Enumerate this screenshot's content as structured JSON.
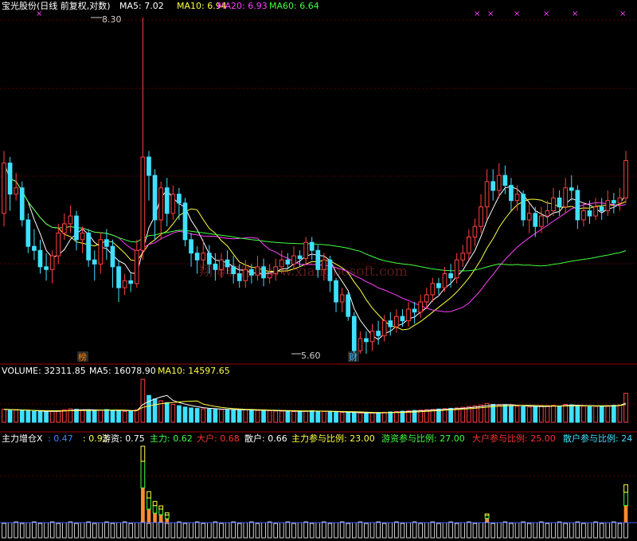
{
  "header": {
    "stock": "宝光股份(日线 前复权,对数)",
    "ma5_label": "MA5: 7.02",
    "ma10_label": "MA10: 6.94",
    "ma20_label": "MA20: 6.93",
    "ma60_label": "MA60: 6.64"
  },
  "price_panel": {
    "high_mark": "8.30",
    "low_mark": "5.60",
    "tag_bang": "榜",
    "tag_cai": "财",
    "watermark": "翔博软件 www.xiangbosoft.com"
  },
  "volume_panel": {
    "volume_label": "VOLUME: 32311.85",
    "ma5_label": "MA5: 16078.90",
    "ma10_label": "MA10: 14597.65"
  },
  "indicator_panel": {
    "name": "主力增仓X",
    "v1": ": 0.47",
    "v2": ": 0.93",
    "youzi": "游资: 0.75",
    "zhuli": "主力: 0.62",
    "dahu": "大户: 0.68",
    "sanhu": "散户: 0.66",
    "zhuli_ratio": "主力参与比例: 23.00",
    "youzi_ratio": "游资参与比例: 27.00",
    "dahu_ratio": "大户参与比例: 25.00",
    "sanhu_ratio": "散户参与比例: 24"
  },
  "colors": {
    "up": "#ff4040",
    "down": "#40e0ff",
    "ma5": "#ffffff",
    "ma10": "#ffff40",
    "ma20": "#ff40ff",
    "ma60": "#40ff40",
    "grid": "#700000"
  },
  "chart_data": [
    {
      "type": "candlestick",
      "price_range": [
        5.6,
        8.3
      ],
      "scale": "log",
      "candles": [
        [
          6.6,
          7.0,
          6.5,
          7.1
        ],
        [
          7.0,
          6.75,
          6.62,
          7.05
        ],
        [
          6.75,
          6.8,
          6.7,
          6.92
        ],
        [
          6.8,
          6.55,
          6.5,
          6.85
        ],
        [
          6.55,
          6.35,
          6.3,
          6.6
        ],
        [
          6.35,
          6.32,
          6.25,
          6.48
        ],
        [
          6.32,
          6.2,
          6.15,
          6.4
        ],
        [
          6.2,
          6.18,
          6.1,
          6.3
        ],
        [
          6.18,
          6.28,
          6.08,
          6.32
        ],
        [
          6.28,
          6.45,
          6.22,
          6.52
        ],
        [
          6.45,
          6.52,
          6.4,
          6.6
        ],
        [
          6.52,
          6.58,
          6.45,
          6.66
        ],
        [
          6.58,
          6.4,
          6.32,
          6.62
        ],
        [
          6.4,
          6.45,
          6.3,
          6.5
        ],
        [
          6.45,
          6.25,
          6.2,
          6.48
        ],
        [
          6.25,
          6.22,
          6.1,
          6.32
        ],
        [
          6.22,
          6.4,
          6.15,
          6.45
        ],
        [
          6.4,
          6.35,
          6.25,
          6.48
        ],
        [
          6.35,
          6.2,
          6.05,
          6.4
        ],
        [
          6.2,
          6.05,
          5.95,
          6.25
        ],
        [
          6.05,
          6.1,
          6.0,
          6.15
        ],
        [
          6.1,
          6.08,
          6.02,
          6.15
        ],
        [
          6.08,
          6.32,
          6.05,
          6.4
        ],
        [
          6.32,
          7.05,
          6.25,
          8.3
        ],
        [
          7.05,
          6.9,
          6.7,
          7.1
        ],
        [
          6.9,
          6.55,
          6.4,
          6.95
        ],
        [
          6.55,
          6.8,
          6.4,
          6.85
        ],
        [
          6.8,
          6.6,
          6.5,
          6.88
        ],
        [
          6.6,
          6.75,
          6.55,
          6.82
        ],
        [
          6.75,
          6.68,
          6.55,
          6.8
        ],
        [
          6.68,
          6.4,
          6.35,
          6.72
        ],
        [
          6.4,
          6.3,
          6.2,
          6.45
        ],
        [
          6.3,
          6.25,
          6.15,
          6.35
        ],
        [
          6.25,
          6.3,
          6.18,
          6.4
        ],
        [
          6.3,
          6.22,
          6.15,
          6.36
        ],
        [
          6.22,
          6.18,
          6.1,
          6.3
        ],
        [
          6.18,
          6.25,
          6.12,
          6.3
        ],
        [
          6.25,
          6.2,
          6.15,
          6.32
        ],
        [
          6.2,
          6.15,
          6.08,
          6.28
        ],
        [
          6.15,
          6.1,
          6.05,
          6.22
        ],
        [
          6.1,
          6.18,
          6.05,
          6.25
        ],
        [
          6.18,
          6.14,
          6.08,
          6.22
        ],
        [
          6.14,
          6.2,
          6.1,
          6.28
        ],
        [
          6.2,
          6.12,
          6.06,
          6.26
        ],
        [
          6.12,
          6.15,
          6.08,
          6.22
        ],
        [
          6.15,
          6.2,
          6.1,
          6.26
        ],
        [
          6.2,
          6.25,
          6.15,
          6.32
        ],
        [
          6.25,
          6.22,
          6.18,
          6.3
        ],
        [
          6.22,
          6.28,
          6.18,
          6.35
        ],
        [
          6.28,
          6.26,
          6.2,
          6.32
        ],
        [
          6.26,
          6.38,
          6.22,
          6.42
        ],
        [
          6.38,
          6.32,
          6.25,
          6.42
        ],
        [
          6.32,
          6.18,
          6.12,
          6.36
        ],
        [
          6.18,
          6.25,
          6.1,
          6.3
        ],
        [
          6.25,
          6.1,
          6.02,
          6.28
        ],
        [
          6.1,
          5.95,
          5.88,
          6.12
        ],
        [
          5.95,
          6.0,
          5.88,
          6.05
        ],
        [
          6.0,
          5.85,
          5.82,
          6.02
        ],
        [
          5.85,
          5.62,
          5.6,
          5.88
        ],
        [
          5.62,
          5.7,
          5.6,
          5.75
        ],
        [
          5.7,
          5.68,
          5.6,
          5.75
        ],
        [
          5.68,
          5.75,
          5.62,
          5.8
        ],
        [
          5.75,
          5.72,
          5.66,
          5.82
        ],
        [
          5.72,
          5.82,
          5.68,
          5.86
        ],
        [
          5.82,
          5.78,
          5.72,
          5.88
        ],
        [
          5.78,
          5.85,
          5.74,
          5.9
        ],
        [
          5.85,
          5.82,
          5.78,
          5.9
        ],
        [
          5.82,
          5.9,
          5.78,
          5.95
        ],
        [
          5.9,
          5.88,
          5.8,
          5.95
        ],
        [
          5.88,
          5.95,
          5.84,
          6.0
        ],
        [
          5.95,
          6.0,
          5.9,
          6.05
        ],
        [
          6.0,
          6.08,
          5.95,
          6.12
        ],
        [
          6.08,
          6.05,
          6.0,
          6.12
        ],
        [
          6.05,
          6.15,
          6.02,
          6.2
        ],
        [
          6.15,
          6.12,
          6.05,
          6.22
        ],
        [
          6.12,
          6.25,
          6.08,
          6.3
        ],
        [
          6.25,
          6.3,
          6.2,
          6.36
        ],
        [
          6.3,
          6.42,
          6.25,
          6.48
        ],
        [
          6.42,
          6.5,
          6.35,
          6.56
        ],
        [
          6.5,
          6.65,
          6.45,
          6.75
        ],
        [
          6.65,
          6.85,
          6.55,
          6.95
        ],
        [
          6.85,
          6.78,
          6.7,
          6.95
        ],
        [
          6.78,
          6.9,
          6.72,
          7.0
        ],
        [
          6.9,
          6.82,
          6.75,
          6.98
        ],
        [
          6.82,
          6.7,
          6.62,
          6.88
        ],
        [
          6.7,
          6.75,
          6.62,
          6.82
        ],
        [
          6.75,
          6.55,
          6.5,
          6.78
        ],
        [
          6.55,
          6.6,
          6.45,
          6.68
        ],
        [
          6.6,
          6.5,
          6.42,
          6.65
        ],
        [
          6.5,
          6.58,
          6.45,
          6.65
        ],
        [
          6.58,
          6.62,
          6.52,
          6.7
        ],
        [
          6.62,
          6.72,
          6.58,
          6.8
        ],
        [
          6.72,
          6.65,
          6.58,
          6.78
        ],
        [
          6.65,
          6.8,
          6.6,
          6.88
        ],
        [
          6.8,
          6.78,
          6.7,
          6.9
        ],
        [
          6.78,
          6.55,
          6.48,
          6.82
        ],
        [
          6.55,
          6.62,
          6.5,
          6.68
        ],
        [
          6.62,
          6.58,
          6.52,
          6.7
        ],
        [
          6.58,
          6.65,
          6.55,
          6.72
        ],
        [
          6.65,
          6.62,
          6.55,
          6.72
        ],
        [
          6.62,
          6.7,
          6.58,
          6.78
        ],
        [
          6.7,
          6.68,
          6.6,
          6.76
        ],
        [
          6.68,
          6.72,
          6.62,
          6.8
        ],
        [
          6.72,
          7.02,
          6.68,
          7.1
        ]
      ]
    },
    {
      "type": "bar",
      "series": [
        {
          "name": "VOLUME",
          "values": [
            14500,
            14000,
            13500,
            13000,
            12500,
            12200,
            12000,
            11800,
            12200,
            13000,
            14000,
            15000,
            14500,
            13800,
            13200,
            12800,
            13500,
            14200,
            13000,
            12600,
            12200,
            12400,
            14000,
            48000,
            30000,
            26000,
            24000,
            22000,
            20000,
            18500,
            17000,
            16000,
            15500,
            15000,
            14800,
            14500,
            14200,
            14000,
            13800,
            13600,
            13800,
            13500,
            13200,
            13000,
            12800,
            12600,
            12400,
            12200,
            12000,
            12200,
            12600,
            13000,
            12400,
            12000,
            11600,
            11200,
            11000,
            10800,
            10500,
            10300,
            10200,
            10400,
            10800,
            11200,
            11600,
            12000,
            12400,
            12800,
            13200,
            13600,
            14000,
            14400,
            14800,
            15200,
            15600,
            16000,
            16800,
            17600,
            18400,
            19200,
            21000,
            20000,
            19000,
            19500,
            18500,
            18000,
            17500,
            17000,
            17500,
            18000,
            18500,
            19000,
            18000,
            20000,
            19500,
            18500,
            18000,
            17500,
            17800,
            18200,
            18600,
            19000,
            19400,
            32311
          ]
        }
      ]
    }
  ]
}
